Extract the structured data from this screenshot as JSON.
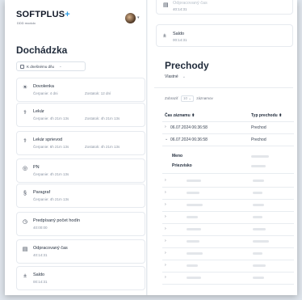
{
  "brand": {
    "name": "SOFTPLUS",
    "plus": "+",
    "sub": "DDD modulo"
  },
  "left": {
    "title": "Dochádzka",
    "filter_label": "K dnešnému dňu",
    "filter_caret": "⌄",
    "cards": [
      {
        "icon": "☀",
        "icon_name": "sun-icon",
        "label": "Dovolenka",
        "sub": "Čerpanie: 4 dni",
        "sub2": "Zostatok: 12 dní"
      },
      {
        "icon": "⚕",
        "icon_name": "doctor-icon",
        "label": "Lekár",
        "sub": "Čerpanie: 4h 21m 13s",
        "sub2": "Zostatok: 4h 21m 13s"
      },
      {
        "icon": "⚕",
        "icon_name": "doctor-escort-icon",
        "label": "Lekár sprievod",
        "sub": "Čerpanie: 6h 21m 13s",
        "sub2": "Zostatok: 4h 21m 13s"
      },
      {
        "icon": "◎",
        "icon_name": "pn-icon",
        "label": "PN",
        "sub": "Čerpanie: 4h 21m 13s",
        "sub2": ""
      },
      {
        "icon": "§",
        "icon_name": "paragraph-icon",
        "label": "Paragraf",
        "sub": "Čerpanie: 4h 21m 13s",
        "sub2": ""
      },
      {
        "icon": "◷",
        "icon_name": "clock-icon",
        "label": "Predpísaný počet hodín",
        "sub": "40:00:00",
        "sub2": ""
      },
      {
        "icon": "▤",
        "icon_name": "worked-time-icon",
        "label": "Odpracovaný čas",
        "sub": "40:14:31",
        "sub2": ""
      },
      {
        "icon": "±",
        "icon_name": "balance-icon",
        "label": "Saldo",
        "sub": "00:14:31",
        "sub2": ""
      }
    ]
  },
  "right": {
    "top_cards": [
      {
        "icon": "▤",
        "icon_name": "worked-time-icon",
        "label": "Odpracovaný čas",
        "sub": "40:14:31"
      },
      {
        "icon": "±",
        "icon_name": "balance-icon",
        "label": "Saldo",
        "sub": "00:14:31"
      }
    ],
    "title": "Prechody",
    "select_value": "Vlastné",
    "select_caret": "⌄",
    "show": {
      "prefix": "Zobraziť",
      "count": "10",
      "suffix": "záznamov"
    },
    "columns": [
      "Čas záznamu ⬍",
      "Typ prechodu ⬍"
    ],
    "rows": [
      {
        "chevron": "›",
        "time": "06.07.2024 06:36:58",
        "type": "Prechod",
        "expanded": false
      },
      {
        "chevron": "⌄",
        "time": "06.07.2024 06:36:58",
        "type": "Prechod",
        "expanded": true
      }
    ],
    "detail_labels": [
      "Meno",
      "Priezvisko"
    ],
    "collapsed_chevron": "›"
  },
  "colors": {
    "accent": "#2f9be0",
    "text": "#1f2a3a",
    "muted": "#8a94a3",
    "border": "#e6eaef"
  }
}
